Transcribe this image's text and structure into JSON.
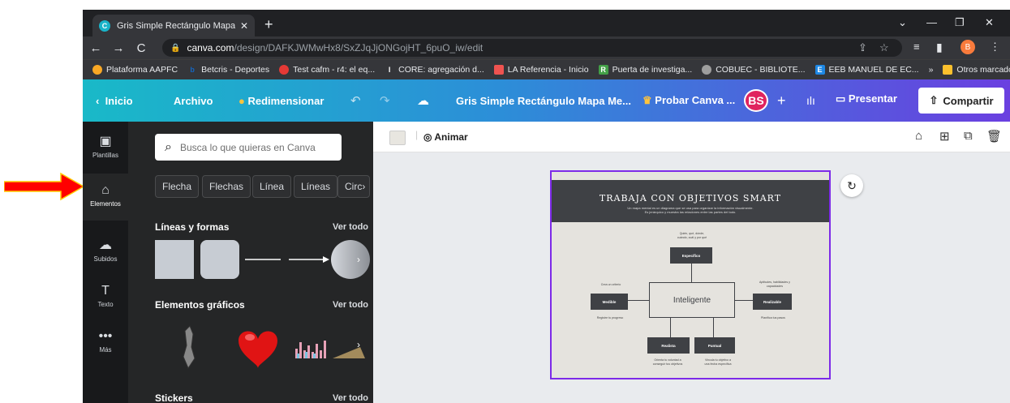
{
  "browser": {
    "tab_title": "Gris Simple Rectángulo Mapa Me",
    "tab_close": "✕",
    "new_tab": "+",
    "url_host": "canva.com",
    "url_path": "/design/DAFKJWMwHx8/SxZJqJjONGojHT_6puO_iw/edit",
    "profile_initial": "B",
    "bookmarks": [
      {
        "label": "Plataforma AAPFC",
        "color": "#f9a825"
      },
      {
        "label": "Betcris - Deportes",
        "color": "#1565c0",
        "glyph": "b"
      },
      {
        "label": "Test cafm - r4: el eq...",
        "color": "#e53935"
      },
      {
        "label": "CORE: agregación d...",
        "color": "#ffffff",
        "glyph": "I"
      },
      {
        "label": "LA Referencia - Inicio",
        "color": "#ef5350"
      },
      {
        "label": "Puerta de investiga...",
        "color": "#43a047",
        "glyph": "R"
      },
      {
        "label": "COBUEC - BIBLIOTE...",
        "color": "#9e9e9e"
      },
      {
        "label": "EEB MANUEL DE EC...",
        "color": "#1e88e5",
        "glyph": "E"
      }
    ],
    "bookmarks_more": "»",
    "other_bookmarks": "Otros marcadores"
  },
  "canva_header": {
    "back": "Inicio",
    "file": "Archivo",
    "resize": "Redimensionar",
    "doc_title": "Gris Simple Rectángulo Mapa Me...",
    "try_pro": "Probar Canva ...",
    "avatar": "BS",
    "add": "+",
    "present": "Presentar",
    "share": "Compartir"
  },
  "rail": [
    {
      "label": "Plantillas",
      "icon": "▢"
    },
    {
      "label": "Elementos",
      "icon": "⌂"
    },
    {
      "label": "Subidos",
      "icon": "☁"
    },
    {
      "label": "Texto",
      "icon": "T"
    },
    {
      "label": "Más",
      "icon": "•••"
    }
  ],
  "panel": {
    "search_placeholder": "Busca lo que quieras en Canva",
    "chips": [
      "Flecha",
      "Flechas",
      "Línea",
      "Líneas",
      "Circ"
    ],
    "section_lines": "Líneas y formas",
    "section_graphics": "Elementos gráficos",
    "section_stickers": "Stickers",
    "see_all": "Ver todo"
  },
  "editor": {
    "animate": "Animar"
  },
  "design": {
    "title": "TRABAJA CON OBJETIVOS SMART",
    "subtitle_1": "Un mapa mental es un diagrama que se usa para organizar la información visualmente.",
    "subtitle_2": "Es jerárquico y muestra las relaciones entre las partes del todo.",
    "center": "Inteligente",
    "top_note_1": "Quién, qué, dónde,",
    "top_note_2": "cuándo, cuál y por qué",
    "box_specific": "Específico",
    "left_note": "Crea un criterio",
    "box_measurable": "Medible",
    "left_note_below": "Registre tu progreso",
    "right_note_1": "Aptitudes, habilidades y",
    "right_note_2": "capacidades",
    "box_achievable": "Realizable",
    "right_note_below": "Planifica tus pasos",
    "box_realistic": "Realista",
    "box_timely": "Puntual",
    "bottom_left_1": "Orienta tu voluntad a",
    "bottom_left_2": "conseguir tus objetivos",
    "bottom_right_1": "Vincula tu objetivo a",
    "bottom_right_2": "una fecha específica"
  },
  "colors": {
    "accent_purple": "#7d2ae8",
    "annotation_arrow": "#ff0000"
  }
}
